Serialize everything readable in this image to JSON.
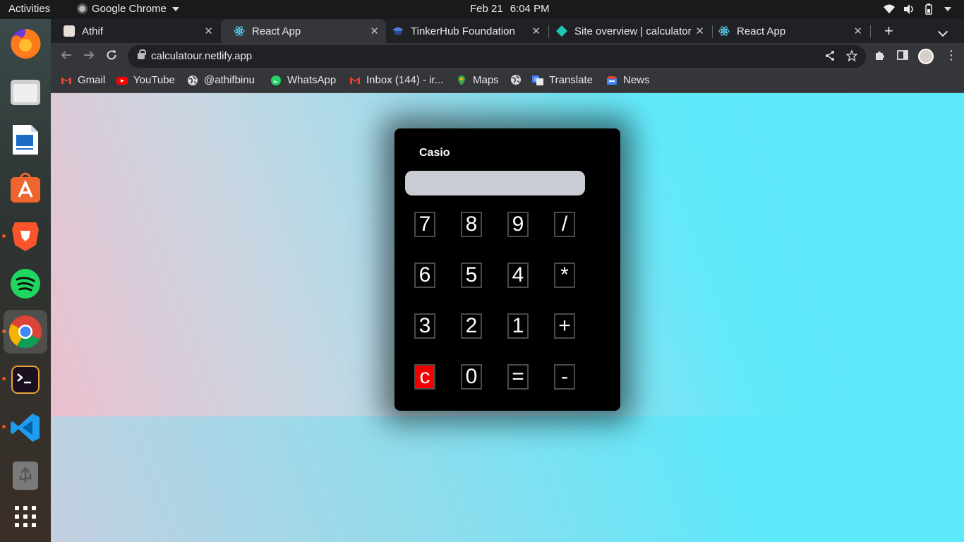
{
  "system": {
    "activities": "Activities",
    "app_name": "Google Chrome",
    "date": "Feb 21",
    "time": "6:04 PM"
  },
  "tabs": [
    {
      "title": "Athif",
      "favicon": "profile-photo"
    },
    {
      "title": "React App",
      "favicon": "react-icon"
    },
    {
      "title": "TinkerHub Foundation",
      "favicon": "graduation-cap-icon"
    },
    {
      "title": "Site overview | calculator",
      "favicon": "netlify-icon"
    },
    {
      "title": "React App",
      "favicon": "react-icon"
    }
  ],
  "address_bar": {
    "url": "calculatour.netlify.app"
  },
  "bookmarks": [
    {
      "label": "Gmail",
      "icon": "gmail-icon"
    },
    {
      "label": "YouTube",
      "icon": "youtube-icon"
    },
    {
      "label": "@athifbinu",
      "icon": "globe-icon"
    },
    {
      "label": "WhatsApp",
      "icon": "whatsapp-icon"
    },
    {
      "label": "Inbox (144) - ir...",
      "icon": "gmail-icon"
    },
    {
      "label": "Maps",
      "icon": "maps-icon"
    },
    {
      "label": "",
      "icon": "globe-icon"
    },
    {
      "label": "Translate",
      "icon": "translate-icon"
    },
    {
      "label": "News",
      "icon": "news-icon"
    }
  ],
  "calculator": {
    "brand": "Casio",
    "display_value": "",
    "keys": [
      [
        "7",
        "8",
        "9",
        "/"
      ],
      [
        "6",
        "5",
        "4",
        "*"
      ],
      [
        "3",
        "2",
        "1",
        "+"
      ],
      [
        "c",
        "0",
        "=",
        "-"
      ]
    ]
  },
  "colors": {
    "clear_key": "#f20000",
    "calculator_body": "#000000",
    "display_bg": "#c9cdd3"
  }
}
